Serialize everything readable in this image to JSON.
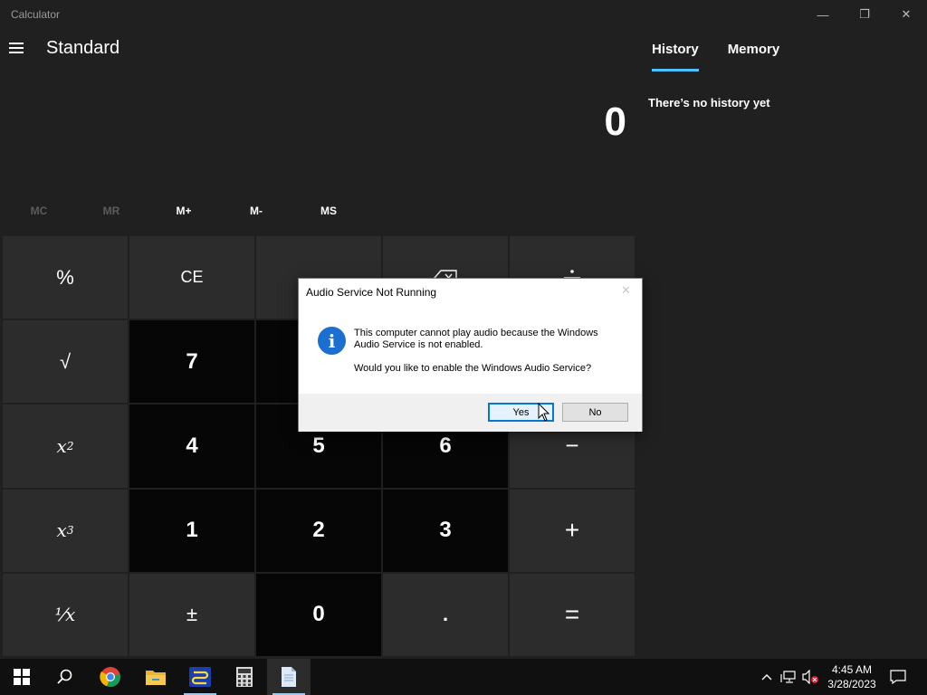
{
  "window": {
    "title": "Calculator",
    "minimize_glyph": "—",
    "maximize_glyph": "❐",
    "close_glyph": "✕"
  },
  "header": {
    "mode_title": "Standard"
  },
  "display": {
    "value": "0"
  },
  "memory_buttons": [
    {
      "label": "MC",
      "enabled": false
    },
    {
      "label": "MR",
      "enabled": false
    },
    {
      "label": "M+",
      "enabled": true
    },
    {
      "label": "M-",
      "enabled": true
    },
    {
      "label": "MS",
      "enabled": true
    }
  ],
  "keypad": {
    "percent": "%",
    "ce": "CE",
    "sqrt": "√",
    "seven": "7",
    "x_base": "x",
    "square_exp": "2",
    "cube_exp": "3",
    "four": "4",
    "five": "5",
    "six": "6",
    "minus": "−",
    "one": "1",
    "two": "2",
    "three": "3",
    "plus": "+",
    "reciprocal": "¹⁄x",
    "negate": "±",
    "zero": "0",
    "decimal": ".",
    "equals": "="
  },
  "side_panel": {
    "tabs": [
      {
        "label": "History",
        "active": true
      },
      {
        "label": "Memory",
        "active": false
      }
    ],
    "empty_message": "There’s no history yet"
  },
  "dialog": {
    "title": "Audio Service Not Running",
    "message": "This computer cannot play audio because the Windows Audio Service is not enabled.",
    "question": "Would you like to enable the Windows Audio Service?",
    "yes_label": "Yes",
    "no_label": "No",
    "icon": "info-icon"
  },
  "taskbar": {
    "apps": [
      "start-icon",
      "search-icon",
      "chrome-icon",
      "file-explorer-icon",
      "network-tool-icon",
      "calculator-icon",
      "notepad-icon"
    ],
    "clock_time": "4:45 AM",
    "clock_date": "3/28/2023"
  }
}
